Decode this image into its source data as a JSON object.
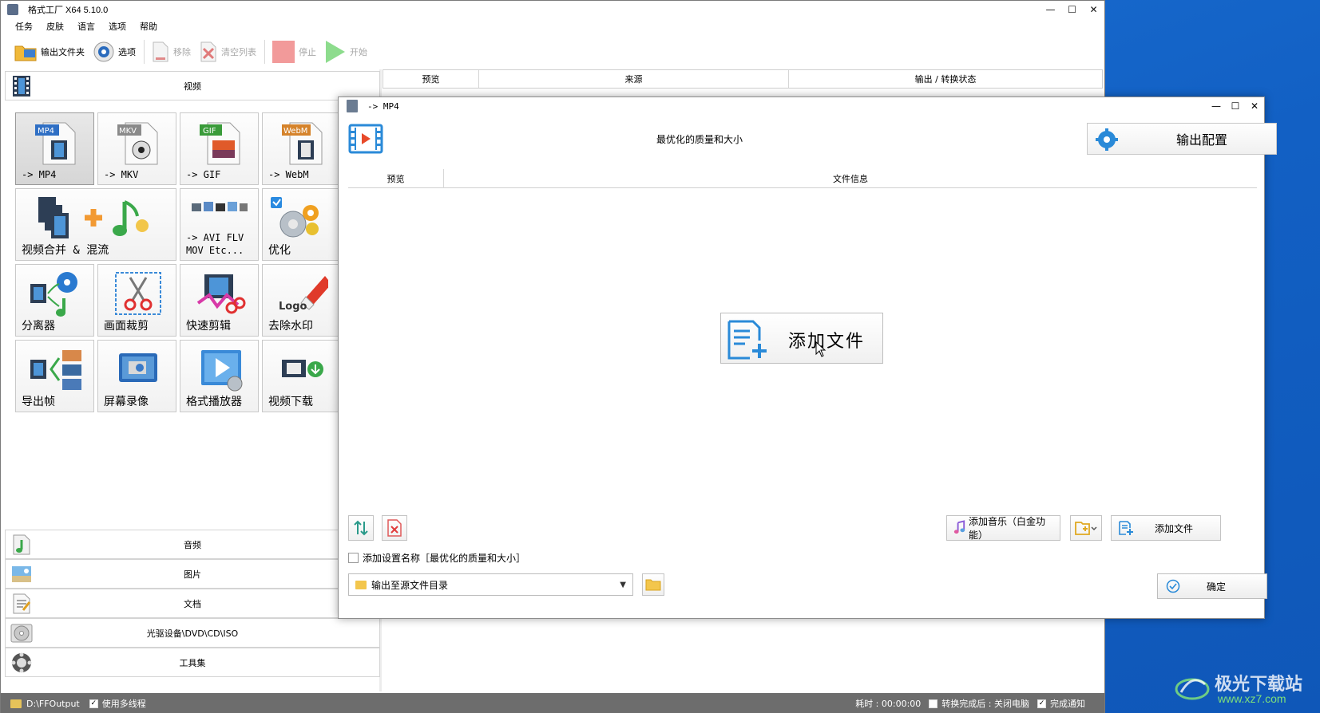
{
  "window": {
    "title": "格式工厂 X64 5.10.0",
    "controls": {
      "minimize": "—",
      "maximize": "☐",
      "close": "✕"
    }
  },
  "menu": [
    "任务",
    "皮肤",
    "语言",
    "选项",
    "帮助"
  ],
  "toolbar": {
    "output_folder": "输出文件夹",
    "options": "选项",
    "remove": "移除",
    "clear_list": "清空列表",
    "stop": "停止",
    "start": "开始"
  },
  "categories": {
    "video": "视频",
    "audio": "音频",
    "image": "图片",
    "document": "文档",
    "disc": "光驱设备\\DVD\\CD\\ISO",
    "tools": "工具集"
  },
  "tiles": [
    {
      "label": "-> MP4",
      "badge": "MP4",
      "badge_color": "#2f6fc4"
    },
    {
      "label": "-> MKV",
      "badge": "MKV",
      "badge_color": "#8a8a8a"
    },
    {
      "label": "-> GIF",
      "badge": "GIF",
      "badge_color": "#3a9b3a"
    },
    {
      "label": "-> WebM",
      "badge": "WebM",
      "badge_color": "#d5832b"
    },
    {
      "label": "视频合并 & 混流"
    },
    {
      "label": "-> AVI FLV\nMOV Etc..."
    },
    {
      "label": "优化"
    },
    {
      "label": "分离器"
    },
    {
      "label": "画面裁剪"
    },
    {
      "label": "快速剪辑"
    },
    {
      "label": "去除水印",
      "logo_text": "Logo"
    },
    {
      "label": "导出帧"
    },
    {
      "label": "屏幕录像"
    },
    {
      "label": "格式播放器"
    },
    {
      "label": "视频下载"
    }
  ],
  "queue_columns": [
    "预览",
    "来源",
    "输出 / 转换状态"
  ],
  "statusbar": {
    "output_path": "D:\\FFOutput",
    "multithread": "使用多线程",
    "elapsed": "耗时 : 00:00:00",
    "after_convert": "转换完成后 : 关闭电脑",
    "notify": "完成通知"
  },
  "dialog": {
    "title": "-> MP4",
    "preset": "最优化的质量和大小",
    "output_config": "输出配置",
    "columns": [
      "预览",
      "文件信息"
    ],
    "add_file_big": "添加文件",
    "add_music": "添加音乐（白金功能）",
    "add_file": "添加文件",
    "add_setting_name": "添加设置名称［最优化的质量和大小］",
    "output_dir": "输出至源文件目录",
    "ok": "确定"
  },
  "watermark": {
    "name": "极光下载站",
    "url": "www.xz7.com"
  }
}
